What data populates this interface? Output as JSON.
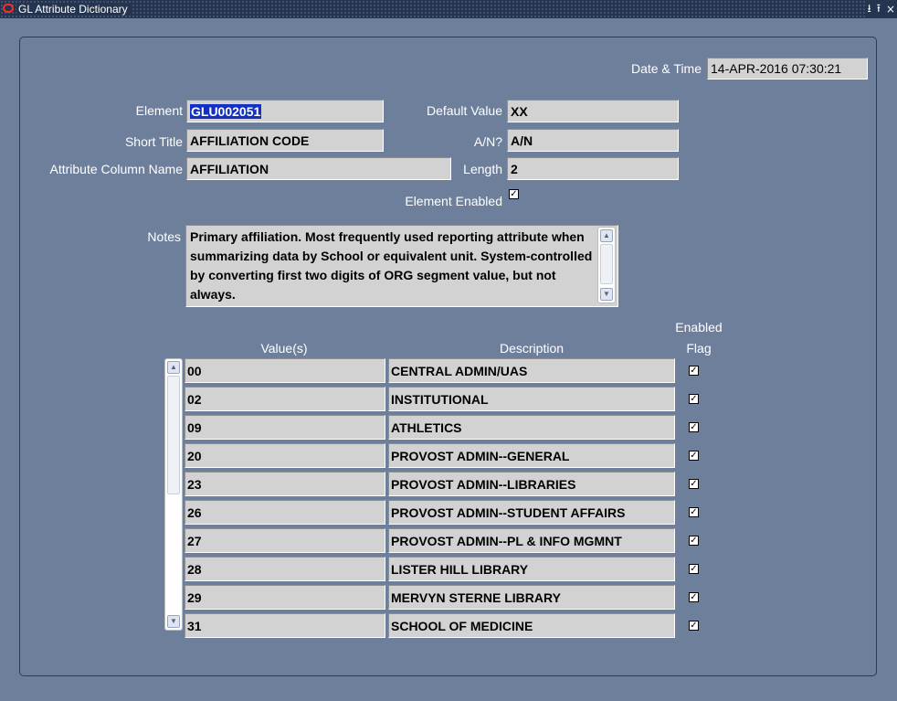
{
  "window": {
    "title": "GL Attribute Dictionary",
    "controls": {
      "minimize": "⭳",
      "maximize": "⭱",
      "close": "×"
    }
  },
  "header": {
    "datetime_label": "Date & Time",
    "datetime_value": "14-APR-2016 07:30:21"
  },
  "form": {
    "element_label": "Element",
    "element_value": "GLU002051",
    "short_title_label": "Short Title",
    "short_title_value": "AFFILIATION CODE",
    "attr_col_label": "Attribute Column Name",
    "attr_col_value": "AFFILIATION",
    "default_value_label": "Default Value",
    "default_value_value": "XX",
    "an_label": "A/N?",
    "an_value": "A/N",
    "length_label": "Length",
    "length_value": "2",
    "enabled_label": "Element Enabled",
    "enabled_checked": true,
    "notes_label": "Notes",
    "notes_value": "Primary affiliation.  Most frequently used reporting attribute when summarizing data by School or equivalent unit.  System-controlled by converting first two digits of ORG segment value, but not always."
  },
  "table": {
    "col_value": "Value(s)",
    "col_description": "Description",
    "col_enabled_line1": "Enabled",
    "col_enabled_line2": "Flag",
    "rows": [
      {
        "value": "00",
        "description": "CENTRAL ADMIN/UAS",
        "enabled": true
      },
      {
        "value": "02",
        "description": "INSTITUTIONAL",
        "enabled": true
      },
      {
        "value": "09",
        "description": "ATHLETICS",
        "enabled": true
      },
      {
        "value": "20",
        "description": "PROVOST ADMIN--GENERAL",
        "enabled": true
      },
      {
        "value": "23",
        "description": "PROVOST ADMIN--LIBRARIES",
        "enabled": true
      },
      {
        "value": "26",
        "description": "PROVOST ADMIN--STUDENT AFFAIRS",
        "enabled": true
      },
      {
        "value": "27",
        "description": "PROVOST ADMIN--PL & INFO MGMNT",
        "enabled": true
      },
      {
        "value": "28",
        "description": "LISTER HILL LIBRARY",
        "enabled": true
      },
      {
        "value": "29",
        "description": "MERVYN STERNE LIBRARY",
        "enabled": true
      },
      {
        "value": "31",
        "description": "SCHOOL OF MEDICINE",
        "enabled": true
      }
    ]
  }
}
